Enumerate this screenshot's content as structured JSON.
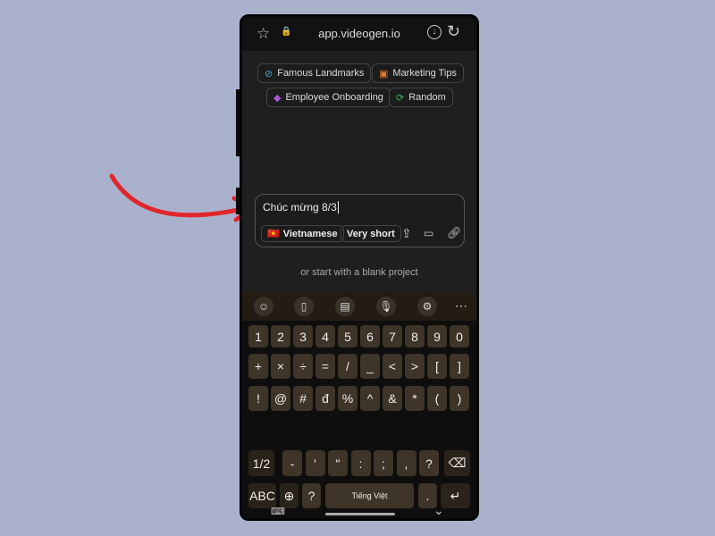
{
  "browser": {
    "url": "app.videogen.io",
    "icons": [
      "star-icon",
      "lock-icon",
      "download-icon",
      "refresh-icon"
    ]
  },
  "suggestions": [
    {
      "label": "Famous Landmarks",
      "icon": "globe-icon",
      "color": "#3aa0d8"
    },
    {
      "label": "Marketing Tips",
      "icon": "briefcase-icon",
      "color": "#e07a2e"
    },
    {
      "label": "Employee Onboarding",
      "icon": "graduation-cap-icon",
      "color": "#a659d6"
    },
    {
      "label": "Random",
      "icon": "shuffle-icon",
      "color": "#33b55a"
    }
  ],
  "prompt": {
    "value": "Chúc mừng 8/3",
    "language": "Vietnamese",
    "language_flag": "🇻🇳",
    "length": "Very short"
  },
  "blank_project_text": "or start with a blank project",
  "annotation": {
    "arrow_color": "#e0262b"
  },
  "keyboard": {
    "toolbar": [
      "emoji-icon",
      "clipboard-icon",
      "notes-icon",
      "microphone-icon",
      "settings-icon",
      "more-icon"
    ],
    "row1": [
      "1",
      "2",
      "3",
      "4",
      "5",
      "6",
      "7",
      "8",
      "9",
      "0"
    ],
    "row2": [
      "+",
      "×",
      "÷",
      "=",
      "/",
      "_",
      "<",
      ">",
      "[",
      "]"
    ],
    "row3": [
      "!",
      "@",
      "#",
      "đ",
      "%",
      "^",
      "&",
      "*",
      "(",
      ")"
    ],
    "row4": [
      "1/2",
      "-",
      "'",
      "\"",
      ":",
      ";",
      ",",
      "?"
    ],
    "row5": {
      "abc": "ABC",
      "q": "?",
      "space": "Tiếng Việt",
      "period": "."
    }
  }
}
